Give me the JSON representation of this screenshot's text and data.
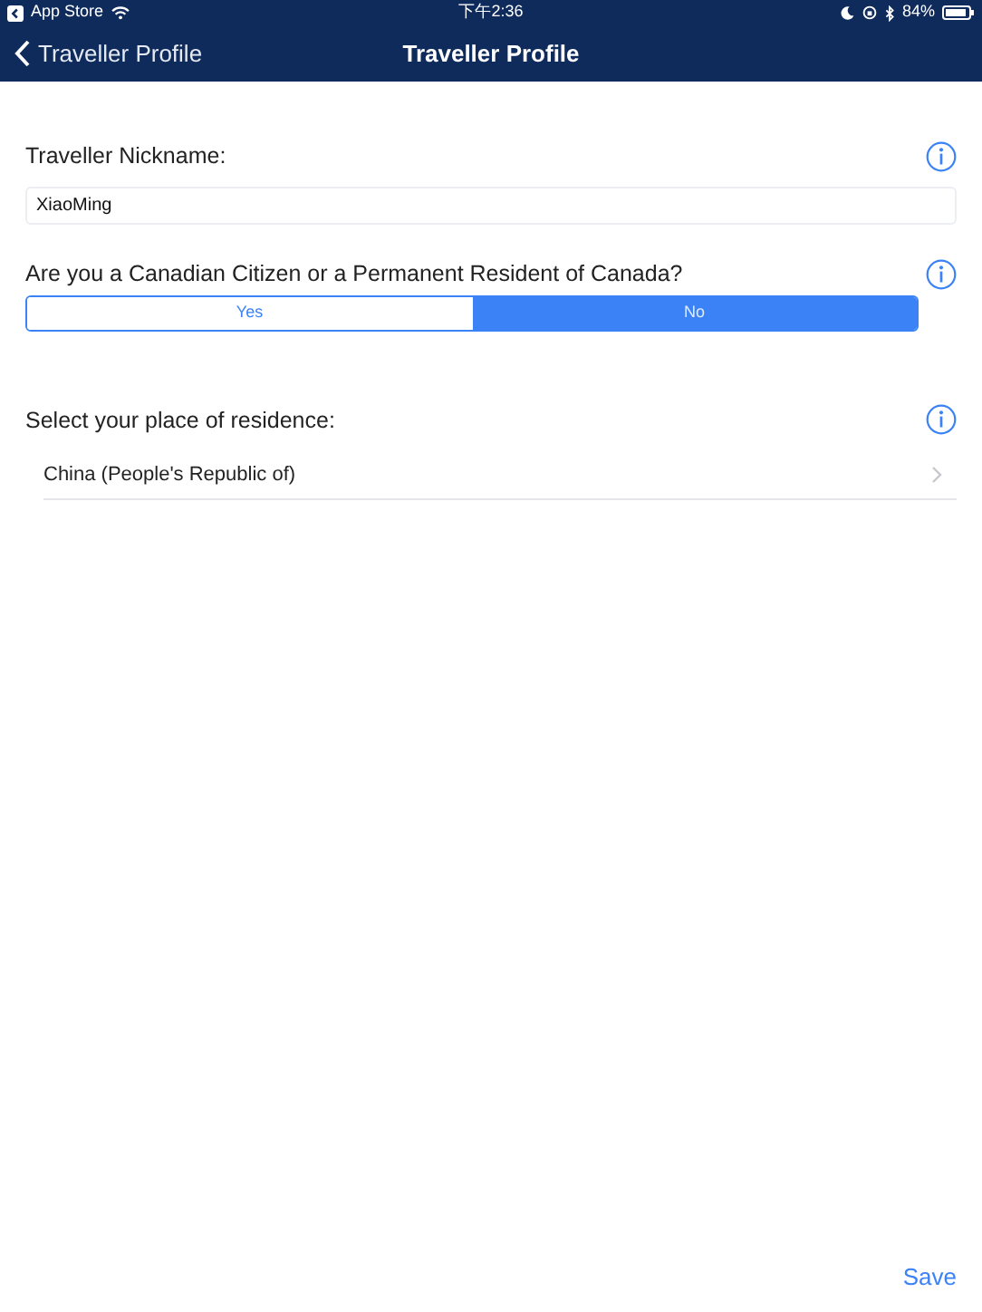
{
  "status_bar": {
    "back_app": "App Store",
    "time": "下午2:36",
    "battery": "84%"
  },
  "nav_bar": {
    "back": "Traveller Profile",
    "title": "Traveller Profile"
  },
  "nickname": {
    "label": "Traveller Nickname:",
    "value": "XiaoMing"
  },
  "citizen": {
    "question": "Are you a Canadian Citizen or a Permanent Resident of Canada?",
    "options": [
      {
        "label": "Yes",
        "selected": false
      },
      {
        "label": "No",
        "selected": true
      }
    ]
  },
  "residence": {
    "label": "Select your place of residence:",
    "value": "China (People's Republic of)"
  },
  "save": "Save"
}
